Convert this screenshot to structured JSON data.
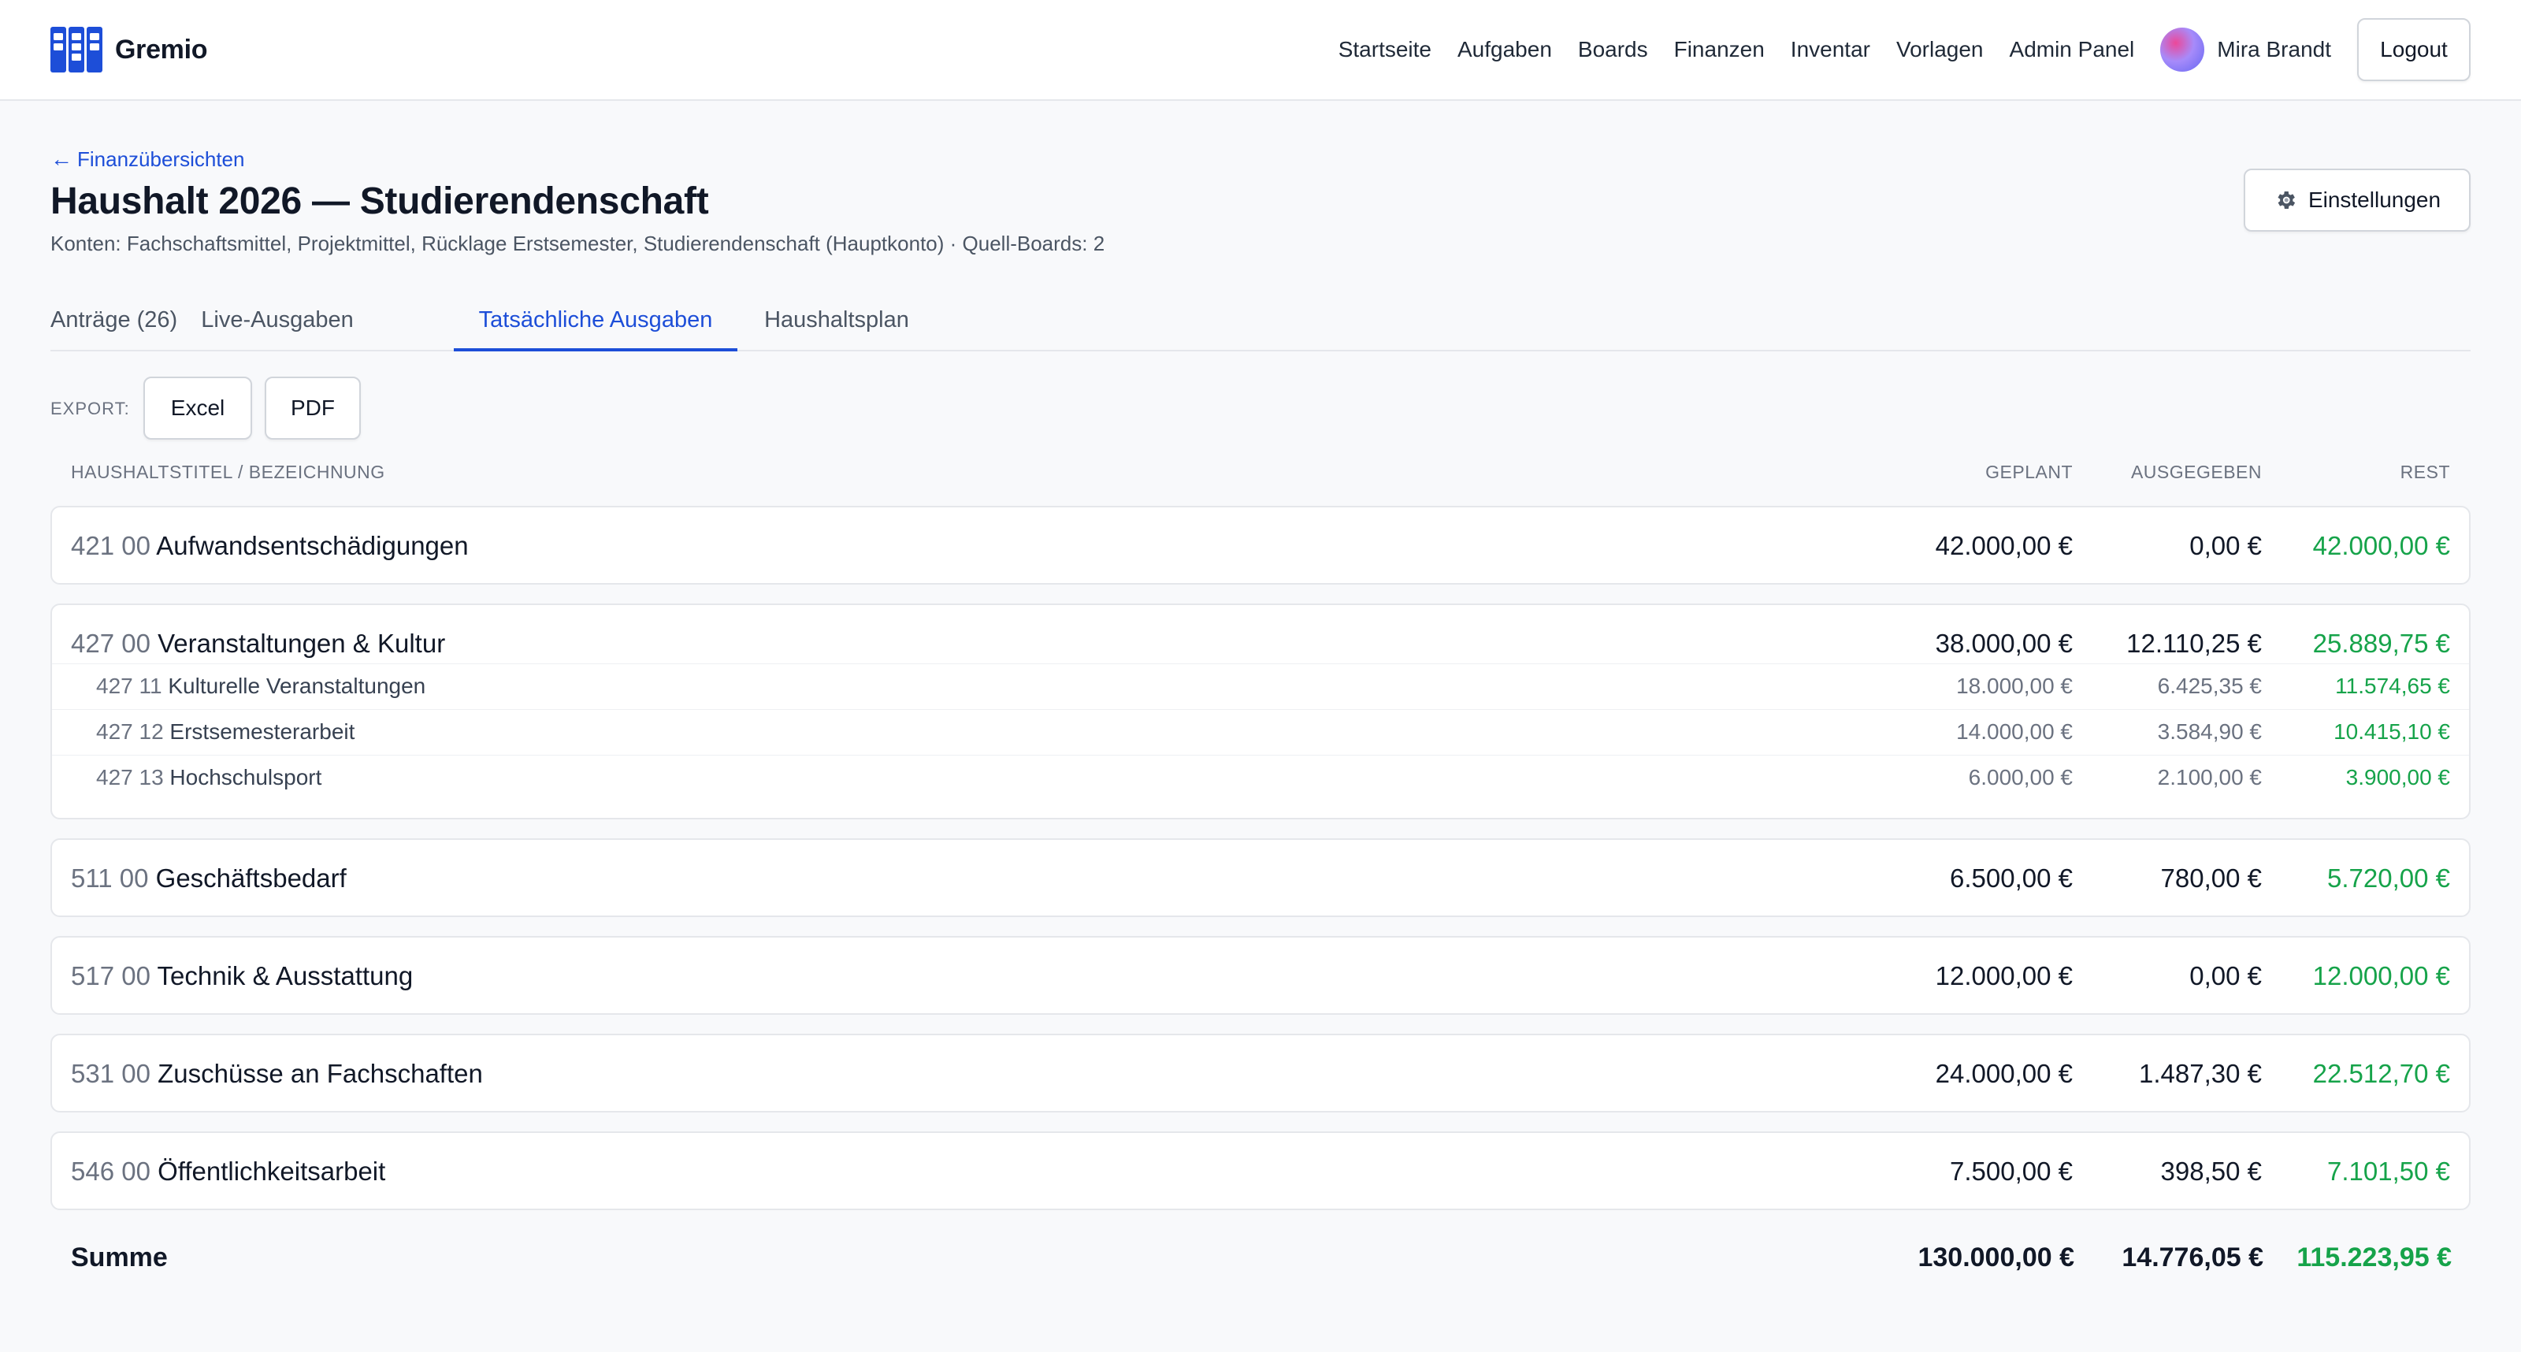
{
  "app": {
    "name": "Gremio",
    "logo_icon": "kanban-board-icon"
  },
  "nav": {
    "links": [
      "Startseite",
      "Aufgaben",
      "Boards",
      "Finanzen",
      "Inventar",
      "Vorlagen",
      "Admin Panel"
    ],
    "user_name": "Mira Brandt",
    "logout_label": "Logout"
  },
  "page": {
    "back_label": "Finanzübersichten",
    "title": "Haushalt 2026 — Studierendenschaft",
    "subtitle": "Konten: Fachschaftsmittel, Projektmittel, Rücklage Erstsemester, Studierendenschaft (Hauptkonto) · Quell-Boards: 2",
    "settings_label": "Einstellungen"
  },
  "tabs": [
    {
      "label": "Anträge (26)",
      "active": false
    },
    {
      "label": "Live-Ausgaben",
      "active": false
    },
    {
      "label": "Tatsächliche Ausgaben",
      "active": true
    },
    {
      "label": "Haushaltsplan",
      "active": false
    }
  ],
  "export": {
    "label": "EXPORT:",
    "excel_label": "Excel",
    "pdf_label": "PDF"
  },
  "table": {
    "headers": {
      "title": "HAUSHALTSTITEL / BEZEICHNUNG",
      "planned": "GEPLANT",
      "spent": "AUSGEGEBEN",
      "rest": "REST"
    },
    "groups": [
      {
        "code": "421 00",
        "name": "Aufwandsentschädigungen",
        "planned": "42.000,00 €",
        "spent": "0,00 €",
        "rest": "42.000,00 €",
        "children": []
      },
      {
        "code": "427 00",
        "name": "Veranstaltungen & Kultur",
        "planned": "38.000,00 €",
        "spent": "12.110,25 €",
        "rest": "25.889,75 €",
        "children": [
          {
            "code": "427 11",
            "name": "Kulturelle Veranstaltungen",
            "planned": "18.000,00 €",
            "spent": "6.425,35 €",
            "rest": "11.574,65 €"
          },
          {
            "code": "427 12",
            "name": "Erstsemesterarbeit",
            "planned": "14.000,00 €",
            "spent": "3.584,90 €",
            "rest": "10.415,10 €"
          },
          {
            "code": "427 13",
            "name": "Hochschulsport",
            "planned": "6.000,00 €",
            "spent": "2.100,00 €",
            "rest": "3.900,00 €"
          }
        ]
      },
      {
        "code": "511 00",
        "name": "Geschäftsbedarf",
        "planned": "6.500,00 €",
        "spent": "780,00 €",
        "rest": "5.720,00 €",
        "children": []
      },
      {
        "code": "517 00",
        "name": "Technik & Ausstattung",
        "planned": "12.000,00 €",
        "spent": "0,00 €",
        "rest": "12.000,00 €",
        "children": []
      },
      {
        "code": "531 00",
        "name": "Zuschüsse an Fachschaften",
        "planned": "24.000,00 €",
        "spent": "1.487,30 €",
        "rest": "22.512,70 €",
        "children": []
      },
      {
        "code": "546 00",
        "name": "Öffentlichkeitsarbeit",
        "planned": "7.500,00 €",
        "spent": "398,50 €",
        "rest": "7.101,50 €",
        "children": []
      }
    ],
    "total": {
      "label": "Summe",
      "planned": "130.000,00 €",
      "spent": "14.776,05 €",
      "rest": "115.223,95 €"
    }
  },
  "colors": {
    "accent": "#1d4ed8",
    "positive": "#16a34a"
  }
}
